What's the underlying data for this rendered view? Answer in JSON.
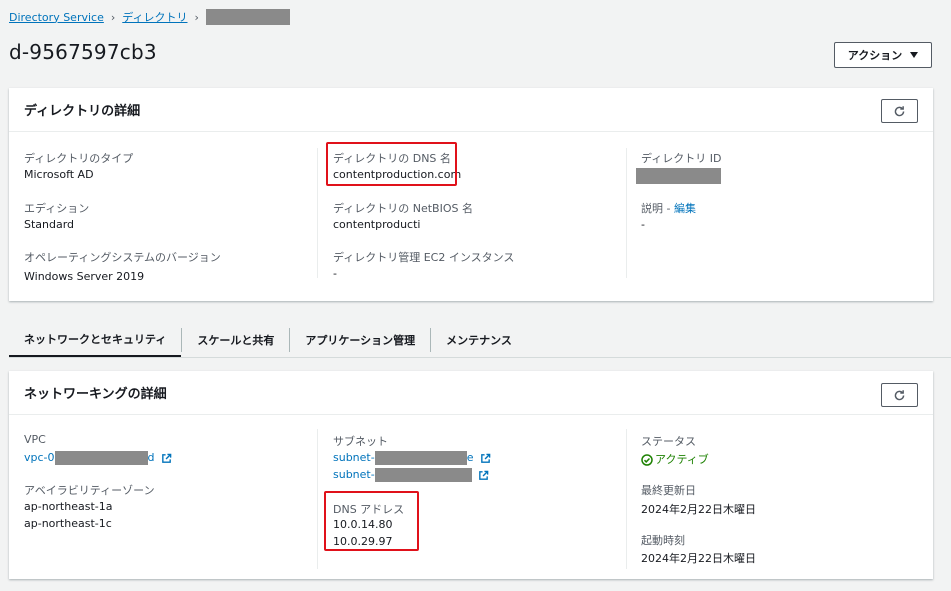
{
  "breadcrumb": {
    "items": [
      "Directory Service",
      "ディレクトリ"
    ]
  },
  "page": {
    "title": "d-9567597cb3"
  },
  "actions": {
    "label": "アクション"
  },
  "details_panel": {
    "title": "ディレクトリの詳細",
    "col1": {
      "type_label": "ディレクトリのタイプ",
      "type_value": "Microsoft AD",
      "edition_label": "エディション",
      "edition_value": "Standard",
      "os_label": "オペレーティングシステムのバージョン",
      "os_value": "Windows Server 2019"
    },
    "col2": {
      "dns_label": "ディレクトリの DNS 名",
      "dns_value": "contentproduction.com",
      "netbios_label": "ディレクトリの NetBIOS 名",
      "netbios_value": "contentproducti",
      "ec2_label": "ディレクトリ管理 EC2 インスタンス",
      "ec2_value": "-"
    },
    "col3": {
      "id_label": "ディレクトリ ID",
      "desc_label": "説明 - ",
      "desc_edit": "編集",
      "desc_value": "-"
    }
  },
  "tabs": [
    {
      "label": "ネットワークとセキュリティ",
      "active": true
    },
    {
      "label": "スケールと共有",
      "active": false
    },
    {
      "label": "アプリケーション管理",
      "active": false
    },
    {
      "label": "メンテナンス",
      "active": false
    }
  ],
  "network_panel": {
    "title": "ネットワーキングの詳細",
    "col1": {
      "vpc_label": "VPC",
      "vpc_prefix": "vpc-0",
      "vpc_suffix": "d",
      "az_label": "アベイラビリティーゾーン",
      "az_1": "ap-northeast-1a",
      "az_2": "ap-northeast-1c"
    },
    "col2": {
      "subnet_label": "サブネット",
      "subnet_1_prefix": "subnet-",
      "subnet_1_suffix": "e",
      "subnet_2_prefix": "subnet-",
      "dns_label": "DNS アドレス",
      "dns_1": "10.0.14.80",
      "dns_2": "10.0.29.97"
    },
    "col3": {
      "status_label": "ステータス",
      "status_value": "アクティブ",
      "updated_label": "最終更新日",
      "updated_value": "2024年2月22日木曜日",
      "launch_label": "起動時刻",
      "launch_value": "2024年2月22日木曜日"
    }
  },
  "colors": {
    "link": "#0073bb",
    "highlight": "#e0111a",
    "status_ok": "#1d8102",
    "redaction": "#8a8a8a"
  }
}
